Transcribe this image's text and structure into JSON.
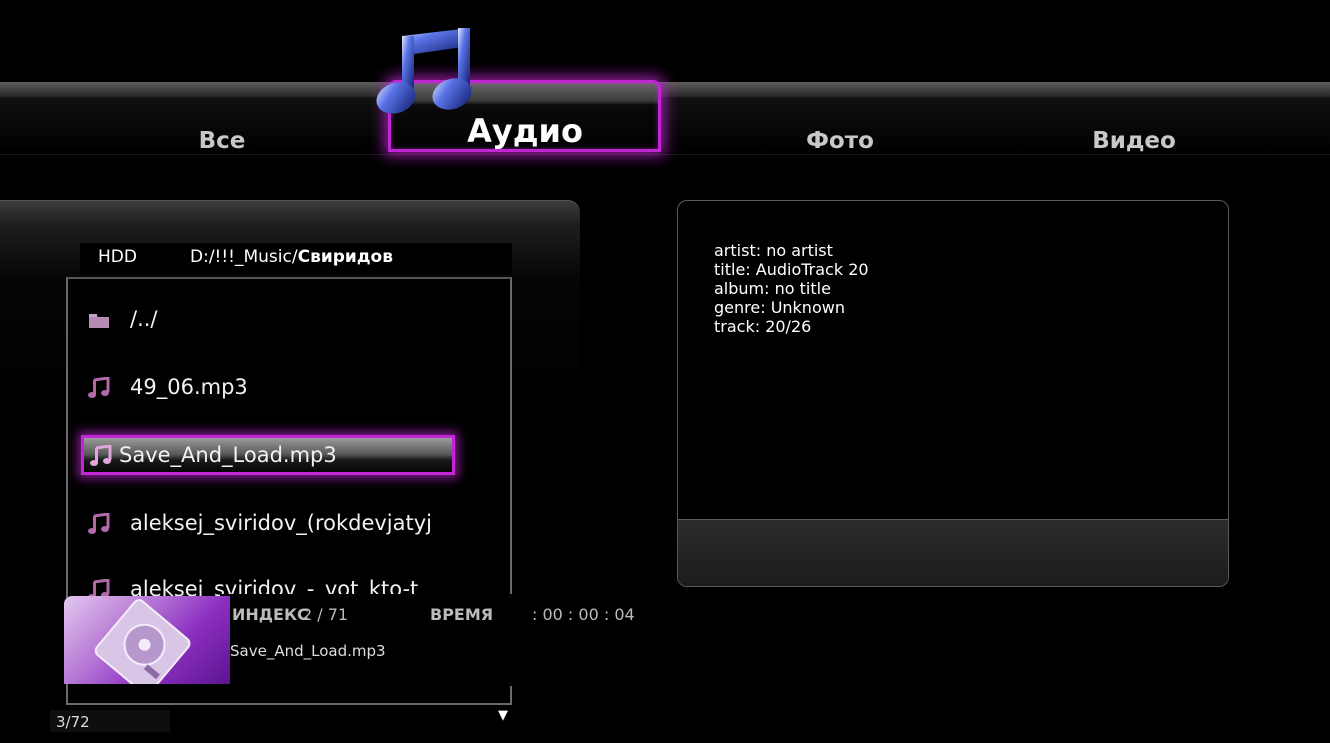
{
  "tabs": [
    {
      "label": "Все"
    },
    {
      "label": "Аудио"
    },
    {
      "label": "Фото"
    },
    {
      "label": "Видео"
    }
  ],
  "active_tab": "Аудио",
  "browser": {
    "source": "HDD",
    "path_prefix": "D:/!!!_Music/",
    "path_current": "Свиридов",
    "items": [
      {
        "name": "/../",
        "icon": "folder-icon"
      },
      {
        "name": "49_06.mp3",
        "icon": "music-note-icon"
      },
      {
        "name": "Save_And_Load.mp3",
        "icon": "music-note-icon",
        "selected": true
      },
      {
        "name": "aleksej_sviridov_(rokdevjatyj",
        "icon": "music-note-icon"
      },
      {
        "name": "aleksej_sviridov_-_vot_kto-t",
        "icon": "music-note-icon"
      }
    ],
    "page_counter": "3/72"
  },
  "now_playing": {
    "index_label": "ИНДЕКС",
    "index_value": "2 / 71",
    "time_label": "ВРЕМЯ",
    "time_value": ":   00 : 00 : 04",
    "file": "Save_And_Load.mp3"
  },
  "info": {
    "artist": "artist: no artist",
    "title": "title: AudioTrack 20",
    "album": "album: no title",
    "genre": "genre: Unknown",
    "track": "track: 20/26"
  },
  "colors": {
    "accent": "#c026d3",
    "background": "#000000"
  }
}
